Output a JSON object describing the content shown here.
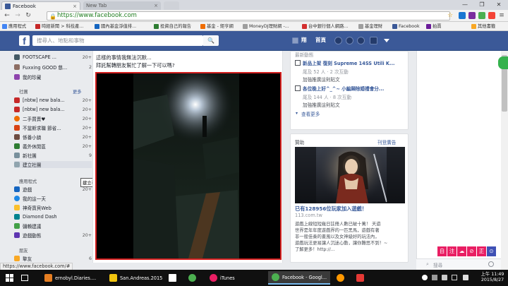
{
  "browser": {
    "tabs": [
      {
        "label": "Facebook",
        "close": "×"
      },
      {
        "label": "New Tab",
        "close": "×"
      }
    ],
    "url": "https://www.facebook.com",
    "window_buttons": [
      "—",
      "❐",
      "✕"
    ],
    "nav_glyphs": {
      "back": "←",
      "forward": "→",
      "reload": "↻",
      "star": "☆",
      "menu": "≡"
    },
    "bookmarks": [
      "應用程式",
      "時經新聞 > 科技產...",
      "國內基金淨值排...",
      "投資自己的報告",
      "基金 - 鉅亨網",
      "MoneyDJ理財網 -...",
      "台中銀行個人網路...",
      "基金理財",
      "Facebook",
      "拍賣",
      "其他書籤"
    ]
  },
  "facebook": {
    "logo": "f",
    "search_placeholder": "搜尋人、地點和事物",
    "search_glyph": "🔍",
    "user_name": "翔",
    "home_label": "首頁",
    "left": {
      "items_top": [
        {
          "label": "FOOTSCAPE ...",
          "count": "20+"
        },
        {
          "label": "Fuxxing GOOD 慈...",
          "count": "2"
        },
        {
          "label": "我的珍藏",
          "count": ""
        }
      ],
      "groups_header": "社團",
      "groups_more": "更多",
      "groups": [
        {
          "label": "[nbtw] new bala...",
          "count": "20+"
        },
        {
          "label": "[nbtw] new bala...",
          "count": "20+"
        },
        {
          "label": "二手買賣♥",
          "count": "20+"
        },
        {
          "label": "不當斯求職 節省...",
          "count": "20+"
        },
        {
          "label": "係番小鎮",
          "count": "20+"
        },
        {
          "label": "義外休閒區",
          "count": "20+"
        },
        {
          "label": "新社團",
          "count": "9"
        },
        {
          "label": "建立社團",
          "count": ""
        }
      ],
      "apps_header": "應用程式",
      "apps": [
        {
          "label": "遊戲",
          "count": "20+"
        },
        {
          "label": "我的這一天",
          "count": ""
        },
        {
          "label": "神奇寶貝Web",
          "count": ""
        },
        {
          "label": "Diamond Dash",
          "count": ""
        },
        {
          "label": "彌賴建議",
          "count": ""
        },
        {
          "label": "遊戲動態",
          "count": "20+"
        }
      ],
      "friends_header": "朋友",
      "friends": [
        {
          "label": "摯友",
          "count": "6"
        }
      ],
      "tooltip": "建立社團"
    },
    "post": {
      "line1": "這樣的事情我無法沉默...",
      "line2": "拜託幫轉朋友幫忙了解一下可以嗎?"
    },
    "right": {
      "top_label": "最新動態",
      "items": [
        {
          "title": "新品上架 復刻 Supreme 14SS Utili K...",
          "meta": "尾及 52 人 · 2 次互動",
          "link": "加強推廣這則貼文"
        },
        {
          "title": "各位晚上好^_^~ 小編歸除婚禮會分...",
          "meta": "尾及 144 人 · 8 次互動",
          "link": "加強推廣這則貼文"
        }
      ],
      "see_more": "查看更多",
      "sponsored": "贊助",
      "create_ad": "刊登廣告",
      "ad_title": "已有128956位玩家加入遊戲！",
      "ad_domain": "113.com.tw",
      "ad_body": [
        "遊戲上線短短幾日註冊人數已破十萬！ 天遊",
        "世界是年年度遊戲界的一匹黑馬，遊戲有著",
        "非一般佳奏的畫風以及女神級好的玩法內，",
        "遊戲玩法更易讓人沉迷心動，讓你難思不到！~",
        "了解更多！http://..."
      ]
    },
    "chat_search": "搜尋",
    "ime_keys": [
      "自",
      "注",
      "☁",
      "⊘",
      "正",
      "⊙"
    ]
  },
  "status_url": "https://www.facebook.com/#",
  "taskbar": {
    "items": [
      "ernobyl.Diaries....",
      "San.Andreas.2015....",
      "",
      "",
      "iTunes",
      "Facebook - Googl...",
      "",
      ""
    ],
    "time": "上午 11:49",
    "date": "2015/8/27"
  }
}
